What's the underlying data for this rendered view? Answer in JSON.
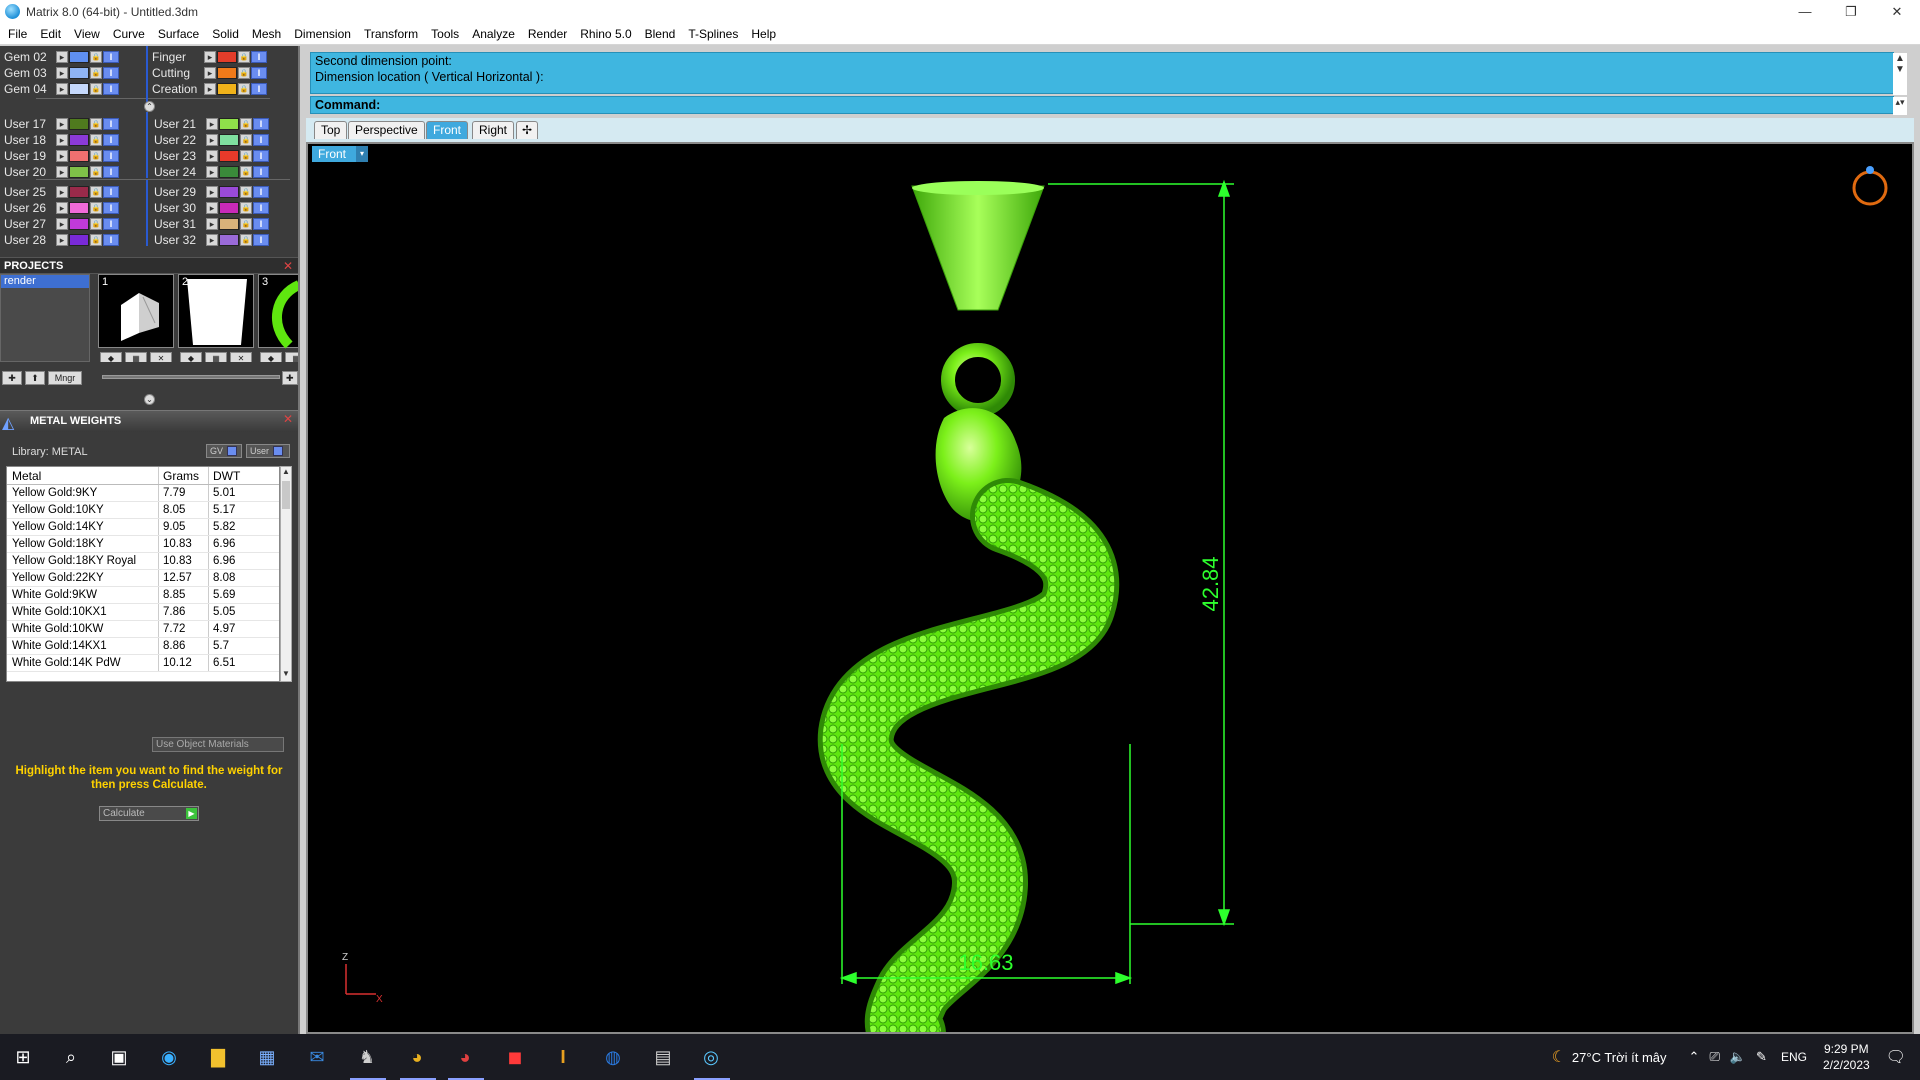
{
  "window": {
    "title": "Matrix 8.0 (64-bit) - Untitled.3dm",
    "minimize_label": "—",
    "restore_label": "❐",
    "close_label": "✕"
  },
  "menu": [
    "File",
    "Edit",
    "View",
    "Curve",
    "Surface",
    "Solid",
    "Mesh",
    "Dimension",
    "Transform",
    "Tools",
    "Analyze",
    "Render",
    "Rhino 5.0",
    "Blend",
    "T-Splines",
    "Help"
  ],
  "layers": {
    "gems": [
      {
        "name": "Gem 02",
        "color": "#5f8ff0"
      },
      {
        "name": "Gem 03",
        "color": "#8fb4f4"
      },
      {
        "name": "Gem 04",
        "color": "#c5d8fb"
      }
    ],
    "special": [
      {
        "name": "Finger",
        "color": "#e43d2a"
      },
      {
        "name": "Cutting",
        "color": "#f07a1a"
      },
      {
        "name": "Creation",
        "color": "#f0b21a"
      }
    ],
    "users_a_left": [
      {
        "name": "User 17",
        "color": "#4f7a1e"
      },
      {
        "name": "User 18",
        "color": "#8b3ad8"
      },
      {
        "name": "User 19",
        "color": "#f07070"
      },
      {
        "name": "User 20",
        "color": "#7fc048"
      }
    ],
    "users_a_right": [
      {
        "name": "User 21",
        "color": "#8fe04a"
      },
      {
        "name": "User 22",
        "color": "#7fe0a0"
      },
      {
        "name": "User 23",
        "color": "#e83a2a"
      },
      {
        "name": "User 24",
        "color": "#3a8a3a"
      }
    ],
    "users_b_left": [
      {
        "name": "User 25",
        "color": "#9a2a4a"
      },
      {
        "name": "User 26",
        "color": "#f06ad8"
      },
      {
        "name": "User 27",
        "color": "#c03ad8"
      },
      {
        "name": "User 28",
        "color": "#7a2ad8"
      }
    ],
    "users_b_right": [
      {
        "name": "User 29",
        "color": "#9a4ad8"
      },
      {
        "name": "User 30",
        "color": "#c82ab8"
      },
      {
        "name": "User 31",
        "color": "#d8b27a"
      },
      {
        "name": "User 32",
        "color": "#9a6ad8"
      }
    ]
  },
  "projects": {
    "title": "PROJECTS",
    "items": [
      "render"
    ],
    "thumb_numbers": [
      "1",
      "2",
      "3"
    ],
    "mngr_label": "Mngr"
  },
  "metal_weights": {
    "title": "METAL WEIGHTS",
    "library_label": "Library: METAL",
    "gv_label": "GV",
    "user_label": "User",
    "columns": [
      "Metal",
      "Grams",
      "DWT"
    ],
    "rows": [
      [
        "Yellow Gold:9KY",
        "7.79",
        "5.01"
      ],
      [
        "Yellow Gold:10KY",
        "8.05",
        "5.17"
      ],
      [
        "Yellow Gold:14KY",
        "9.05",
        "5.82"
      ],
      [
        "Yellow Gold:18KY",
        "10.83",
        "6.96"
      ],
      [
        "Yellow Gold:18KY Royal",
        "10.83",
        "6.96"
      ],
      [
        "Yellow Gold:22KY",
        "12.57",
        "8.08"
      ],
      [
        "White Gold:9KW",
        "8.85",
        "5.69"
      ],
      [
        "White Gold:10KX1",
        "7.86",
        "5.05"
      ],
      [
        "White Gold:10KW",
        "7.72",
        "4.97"
      ],
      [
        "White Gold:14KX1",
        "8.86",
        "5.7"
      ],
      [
        "White Gold:14K PdW",
        "10.12",
        "6.51"
      ]
    ],
    "use_object_materials": "Use Object Materials",
    "hint": "Highlight the item you want to find the weight for then press Calculate.",
    "calculate_label": "Calculate"
  },
  "command": {
    "history": [
      "Second dimension point:",
      "Dimension location ( Vertical  Horizontal ):"
    ],
    "prompt_label": "Command:",
    "value": ""
  },
  "viewports": {
    "tabs": [
      "Top",
      "Perspective",
      "Front",
      "Right"
    ],
    "active_tab": "Front",
    "active_label": "Front",
    "dimension_height": "42.84",
    "dimension_width": "16.63",
    "axis_z": "Z",
    "axis_x": "X"
  },
  "taskbar": {
    "weather": "27°C  Trời ít mây",
    "language": "ENG",
    "time": "9:29 PM",
    "date": "2/2/2023"
  },
  "colors": {
    "command_bg": "#3fb6e0",
    "model_green": "#5fe60f",
    "dimension_green": "#2dff2d",
    "hint_yellow": "#ffd200"
  }
}
